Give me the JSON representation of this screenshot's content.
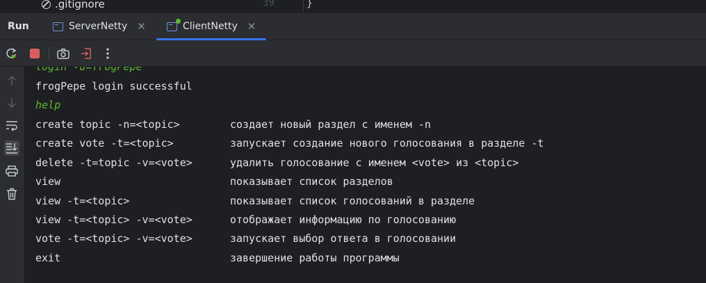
{
  "editor": {
    "file_name": ".gitignore",
    "line_number": "39",
    "code_fragment": "}"
  },
  "run_panel": {
    "title": "Run",
    "tabs": [
      {
        "label": "ServerNetty",
        "active": false
      },
      {
        "label": "ClientNetty",
        "active": true
      }
    ],
    "accent_color": "#3574f0"
  },
  "console": {
    "partial_line": "login -u=frogPepe",
    "login_result": "frogPepe login successful",
    "typed_command": "help",
    "help_rows": [
      {
        "cmd": "create topic -n=<topic>",
        "desc": "создает новый раздел с именем -n"
      },
      {
        "cmd": "create vote -t=<topic>",
        "desc": "запускает создание нового голосования в разделе -t"
      },
      {
        "cmd": "delete -t=topic -v=<vote>",
        "desc": "удалить голосование с именем <vote> из <topic>"
      },
      {
        "cmd": "view",
        "desc": "показывает список разделов"
      },
      {
        "cmd": "view -t=<topic>",
        "desc": "показывает список голосований в разделе"
      },
      {
        "cmd": "view -t=<topic> -v=<vote>",
        "desc": "отображает информацию по голосованию"
      },
      {
        "cmd": "vote -t=<topic> -v=<vote>",
        "desc": "запускает выбор ответа в голосовании"
      },
      {
        "cmd": "exit",
        "desc": "завершение работы программы"
      }
    ],
    "input_color": "#5fb832"
  },
  "toolbar_icons": [
    "rerun-icon",
    "stop-icon",
    "camera-icon",
    "exit-icon",
    "more-icon"
  ],
  "sidebar_icons": [
    "arrow-up-icon",
    "arrow-down-icon",
    "soft-wrap-icon",
    "scroll-to-end-icon",
    "print-icon",
    "trash-icon"
  ]
}
